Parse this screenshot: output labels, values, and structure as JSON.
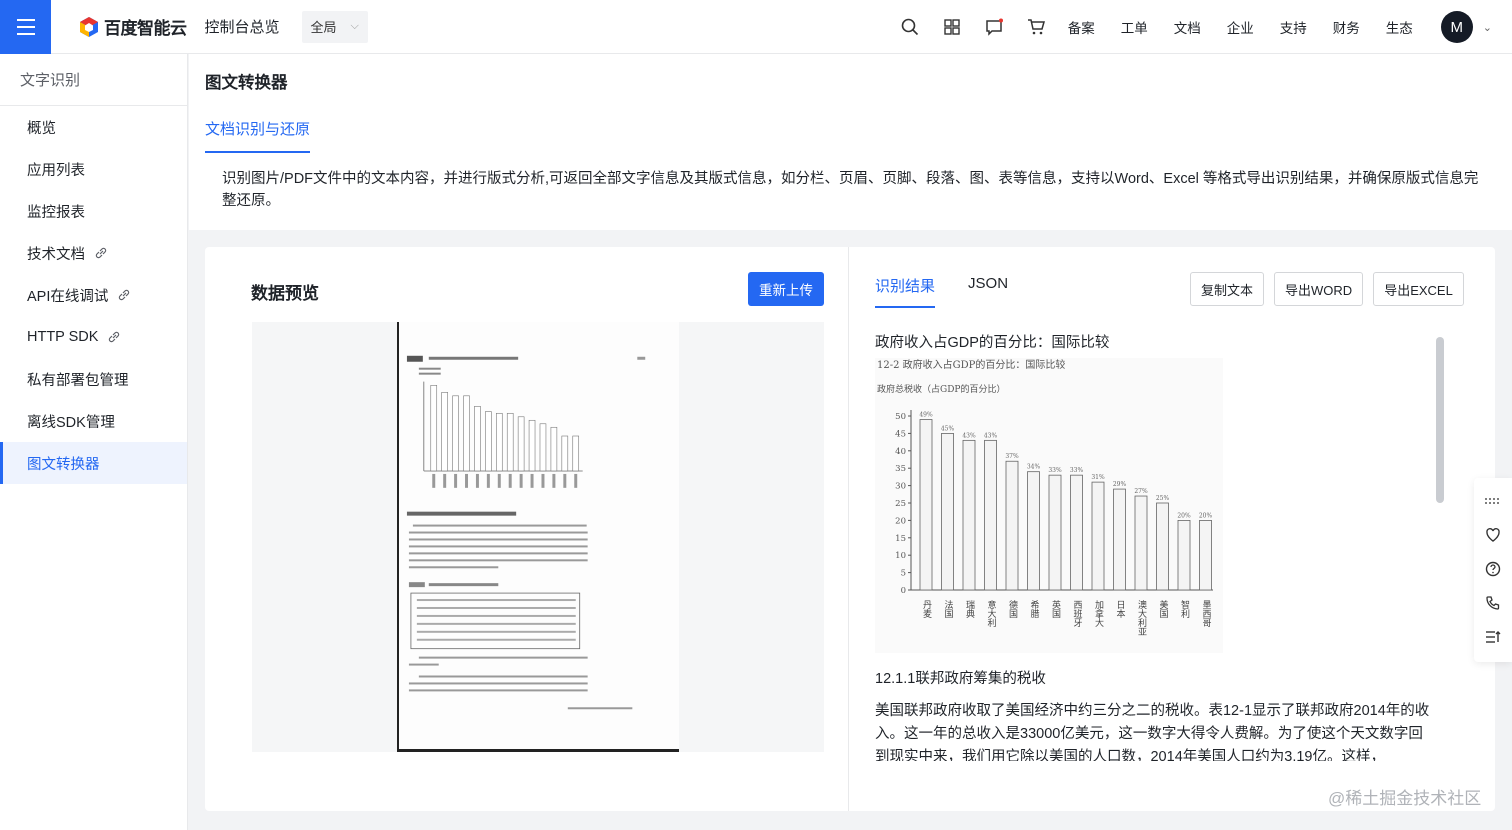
{
  "topbar": {
    "brand": "百度智能云",
    "console": "控制台总览",
    "region": "全局",
    "nav": [
      "备案",
      "工单",
      "文档",
      "企业",
      "支持",
      "财务",
      "生态"
    ],
    "avatar": "M",
    "icons": [
      "search-icon",
      "grid-icon",
      "message-icon",
      "cart-icon"
    ]
  },
  "sidebar": {
    "title": "文字识别",
    "items": [
      {
        "label": "概览",
        "link": false
      },
      {
        "label": "应用列表",
        "link": false
      },
      {
        "label": "监控报表",
        "link": false
      },
      {
        "label": "技术文档",
        "link": true
      },
      {
        "label": "API在线调试",
        "link": true
      },
      {
        "label": "HTTP SDK",
        "link": true
      },
      {
        "label": "私有部署包管理",
        "link": false
      },
      {
        "label": "离线SDK管理",
        "link": false
      },
      {
        "label": "图文转换器",
        "link": false,
        "active": true
      }
    ]
  },
  "page": {
    "title": "图文转换器",
    "tab": "文档识别与还原",
    "description": "识别图片/PDF文件中的文本内容，并进行版式分析,可返回全部文字信息及其版式信息，如分栏、页眉、页脚、段落、图、表等信息，支持以Word、Excel 等格式导出识别结果，并确保原版式信息完整还原。"
  },
  "preview": {
    "title": "数据预览",
    "reupload": "重新上传"
  },
  "result": {
    "tabs": [
      "识别结果",
      "JSON"
    ],
    "buttons": [
      "复制文本",
      "导出WORD",
      "导出EXCEL"
    ],
    "heading": "政府收入占GDP的百分比：国际比较",
    "subheading": "12.1.1联邦政府筹集的税收",
    "paragraph": "美国联邦政府收取了美国经济中约三分之二的税收。表12-1显示了联邦政府2014年的收入。这一年的总收入是33000亿美元，这一数字大得令人费解。为了使这个天文数字回到现实中来，我们用它除以美国的人口数，2014年美国人口约为3.19亿。这样，"
  },
  "chart_data": {
    "type": "bar",
    "title": "12-2 政府收入占GDP的百分比：国际比较",
    "ylabel": "政府总税收（占GDP的百分比）",
    "ylim": [
      0,
      50
    ],
    "yticks": [
      0,
      5,
      10,
      15,
      20,
      25,
      30,
      35,
      40,
      45,
      50
    ],
    "categories": [
      "丹麦",
      "法国",
      "瑞典",
      "意大利",
      "德国",
      "希腊",
      "英国",
      "西班牙",
      "加拿大",
      "日本",
      "澳大利亚",
      "美国",
      "智利",
      "墨西哥"
    ],
    "values": [
      49,
      45,
      43,
      43,
      37,
      34,
      33,
      33,
      31,
      29,
      27,
      25,
      20,
      20
    ],
    "value_labels": [
      "49%",
      "45%",
      "43%",
      "43%",
      "37%",
      "34%",
      "33%",
      "33%",
      "31%",
      "29%",
      "27%",
      "25%",
      "20%",
      "20%"
    ]
  },
  "watermark": "@稀土掘金技术社区"
}
